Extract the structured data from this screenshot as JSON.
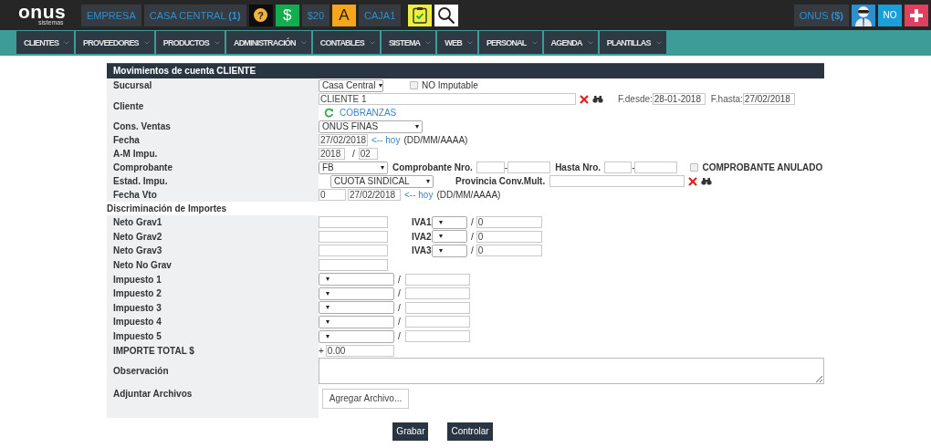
{
  "top_bar": {
    "logo": "onus",
    "logo_sub": "sistemas",
    "company": "EMPRESA",
    "branch": "CASA CENTRAL **(1)**",
    "help": "?",
    "currency": "$",
    "balance": "$20",
    "cash_letter": "A",
    "cash_register": "CAJA1",
    "user": "ONUS **($)**",
    "mode": "NO"
  },
  "nav": [
    {
      "label": "CLIENTES"
    },
    {
      "label": "PROVEEDORES"
    },
    {
      "label": "PRODUCTOS"
    },
    {
      "label": "ADMINISTRACIÓN"
    },
    {
      "label": "CONTABLES"
    },
    {
      "label": "SISTEMA"
    },
    {
      "label": "WEB"
    },
    {
      "label": "PERSONAL"
    },
    {
      "label": "AGENDA"
    },
    {
      "label": "PLANTILLAS"
    }
  ],
  "form": {
    "title": "Movimientos de cuenta CLIENTE",
    "sucursal": {
      "label": "Sucursal",
      "value": "Casa Central",
      "no_imputable": {
        "label": "NO Imputable",
        "checked": false
      }
    },
    "cliente": {
      "label": "Cliente",
      "value": "CLIENTE 1",
      "desde_label": "F.desde:",
      "desde": "28-01-2018",
      "hasta_label": "F.hasta:",
      "hasta": "27/02/2018",
      "link": "COBRANZAS"
    },
    "cons_ventas": {
      "label": "Cons. Ventas",
      "value": "ONUS FINAS"
    },
    "fecha": {
      "label": "Fecha",
      "value": "27/02/2018",
      "today_link": "<-- hoy",
      "format": "(DD/MM/AAAA)"
    },
    "am_impu": {
      "label": "A-M Impu.",
      "year": "2018",
      "sep": "/",
      "month": "02"
    },
    "comprobante": {
      "label": "Comprobante",
      "value": "FB",
      "nro_label": "Comprobante Nro.",
      "nro_sep": "-",
      "hasta_label": "Hasta Nro.",
      "hasta_sep": "-",
      "anulado": {
        "label": "COMPROBANTE ANULADO",
        "checked": false
      }
    },
    "estad_impu": {
      "label": "Estad. Impu.",
      "value": "CUOTA SINDICAL",
      "prov_label": "Provincia Conv.Mult."
    },
    "fecha_vto": {
      "label": "Fecha Vto",
      "days": "0",
      "value": "27/02/2018",
      "today_link": "<-- hoy",
      "format": "(DD/MM/AAAA)"
    },
    "section": "Discriminación de Importes",
    "netos": [
      {
        "label": "Neto Grav1",
        "iva_label": "IVA1",
        "sep": "/",
        "iva_value": "0"
      },
      {
        "label": "Neto Grav2",
        "iva_label": "IVA2",
        "sep": "/",
        "iva_value": "0"
      },
      {
        "label": "Neto Grav3",
        "iva_label": "IVA3",
        "sep": "/",
        "iva_value": "0"
      }
    ],
    "neto_no_grav": {
      "label": "Neto No Grav"
    },
    "impuestos": [
      {
        "label": "Impuesto 1",
        "sep": "/"
      },
      {
        "label": "Impuesto 2",
        "sep": "/"
      },
      {
        "label": "Impuesto 3",
        "sep": "/"
      },
      {
        "label": "Impuesto 4",
        "sep": "/"
      },
      {
        "label": "Impuesto 5",
        "sep": "/"
      }
    ],
    "total": {
      "label": "IMPORTE TOTAL $",
      "sign": "+",
      "value": "0.00"
    },
    "observacion": {
      "label": "Observación"
    },
    "adjuntar": {
      "label": "Adjuntar Archivos",
      "button": "Agregar Archivo..."
    },
    "buttons": [
      "Grabar",
      "Controlar"
    ]
  }
}
